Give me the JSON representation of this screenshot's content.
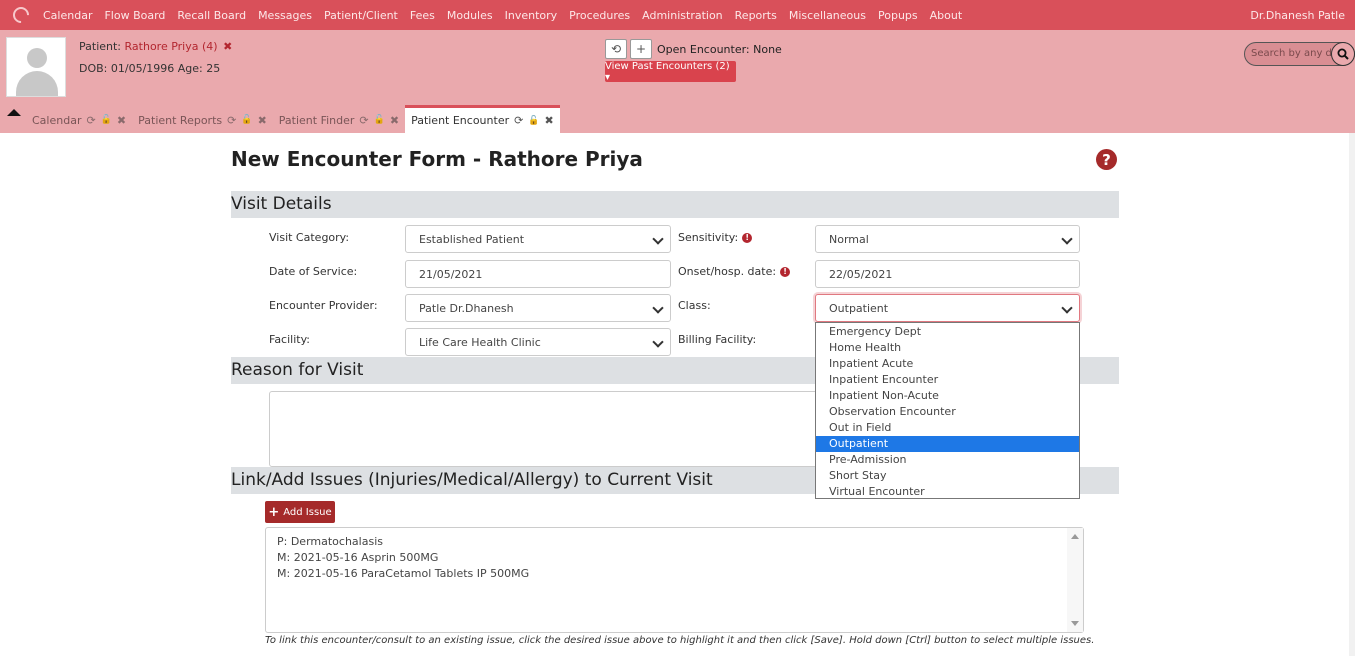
{
  "menu": {
    "items": [
      "Calendar",
      "Flow Board",
      "Recall Board",
      "Messages",
      "Patient/Client",
      "Fees",
      "Modules",
      "Inventory",
      "Procedures",
      "Administration",
      "Reports",
      "Miscellaneous",
      "Popups",
      "About"
    ],
    "user": "Dr.Dhanesh Patle"
  },
  "patient": {
    "label": "Patient:",
    "name": "Rathore Priya (4)",
    "remove": "✖",
    "dob_line": "DOB: 01/05/1996 Age: 25"
  },
  "encounter": {
    "open_label": "Open Encounter: None",
    "past_button": "View Past Encounters  (2) ▾",
    "history_icon": "⟲",
    "add_icon": "+"
  },
  "search": {
    "placeholder": "Search by any demographics",
    "icon": "search-icon"
  },
  "tabs": [
    {
      "label": "Calendar"
    },
    {
      "label": "Patient Reports"
    },
    {
      "label": "Patient Finder"
    },
    {
      "label": "Patient Encounter"
    }
  ],
  "tab_icons": {
    "refresh": "⟳",
    "lock": "🔓",
    "close": "✖"
  },
  "form": {
    "title": "New Encounter Form - Rathore Priya",
    "help": "?",
    "sections": {
      "visit_details": "Visit Details",
      "reason": "Reason for Visit",
      "issues": "Link/Add Issues (Injuries/Medical/Allergy) to Current Visit"
    },
    "labels": {
      "visit_category": "Visit Category:",
      "sensitivity": "Sensitivity:",
      "date_of_service": "Date of Service:",
      "onset_date": "Onset/hosp. date:",
      "encounter_provider": "Encounter Provider:",
      "class": "Class:",
      "facility": "Facility:",
      "billing_facility": "Billing Facility:"
    },
    "required_mark": "!",
    "values": {
      "visit_category": "Established Patient",
      "sensitivity": "Normal",
      "date_of_service": "21/05/2021",
      "onset_date": "22/05/2021",
      "encounter_provider": "Patle Dr.Dhanesh",
      "class": "Outpatient",
      "facility": "Life Care Health Clinic"
    },
    "add_issue": {
      "plus": "+",
      "label": "Add Issue"
    },
    "issues": [
      "P: Dermatochalasis",
      "M: 2021-05-16 Asprin 500MG",
      "M: 2021-05-16 ParaCetamol Tablets IP 500MG"
    ],
    "hint": "To link this encounter/consult to an existing issue, click the desired issue above to highlight it and then click [Save]. Hold down [Ctrl] button to select multiple issues."
  },
  "class_dropdown": {
    "options": [
      "Emergency Dept",
      "Home Health",
      "Inpatient Acute",
      "Inpatient Encounter",
      "Inpatient Non-Acute",
      "Observation Encounter",
      "Out in Field",
      "Outpatient",
      "Pre-Admission",
      "Short Stay",
      "Virtual Encounter"
    ],
    "highlighted": "Outpatient"
  },
  "colors": {
    "menu": "#d9505a",
    "header": "#eaa9ad",
    "accent": "#a52a2a",
    "highlight": "#1e78e6"
  }
}
